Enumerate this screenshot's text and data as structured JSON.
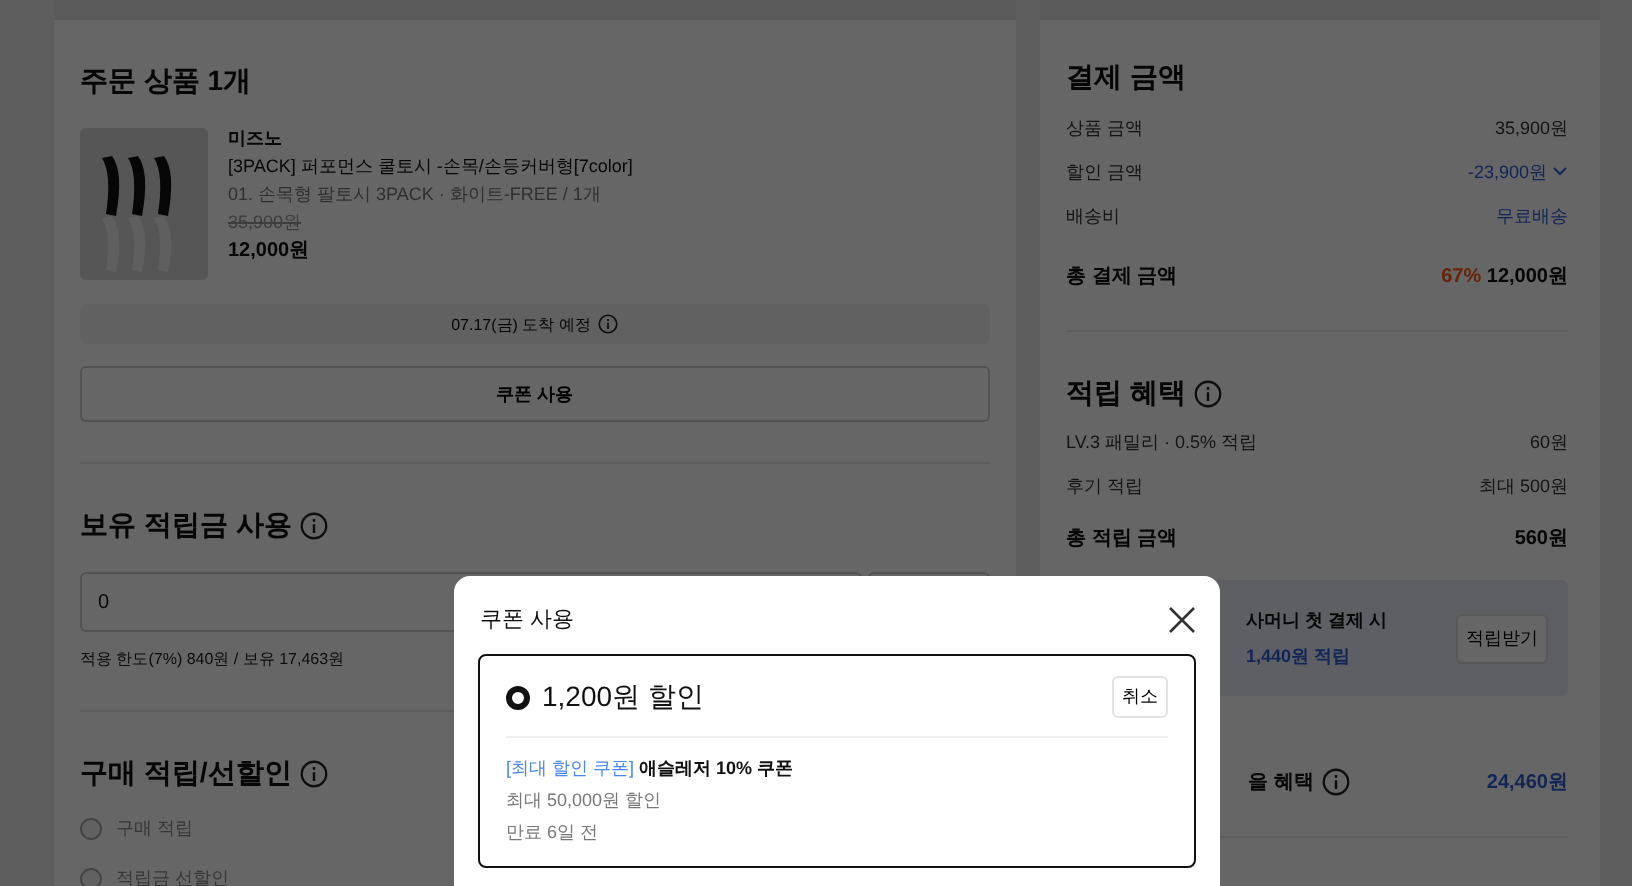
{
  "order": {
    "title": "주문 상품 1개",
    "product": {
      "brand": "미즈노",
      "name": "[3PACK] 퍼포먼스 쿨토시 -손목/손등커버형[7color]",
      "option": "01. 손목형 팔토시 3PACK · 화이트-FREE / 1개",
      "original_price": "35,900원",
      "price": "12,000원"
    },
    "delivery": "07.17(금) 도착 예정",
    "coupon_button": "쿠폰 사용"
  },
  "points": {
    "title": "보유 적립금 사용",
    "value": "0",
    "hint": "적용 한도(7%) 840원 / 보유 17,463원"
  },
  "purchase_benefit": {
    "title": "구매 적립/선할인",
    "options": [
      {
        "label": "구매 적립",
        "selected": false,
        "disabled": true
      },
      {
        "label": "적립금 선할인",
        "selected": false,
        "disabled": true
      }
    ]
  },
  "payment": {
    "title": "결제 금액",
    "rows": [
      {
        "label": "상품 금액",
        "value": "35,900원",
        "kind": "plain"
      },
      {
        "label": "할인 금액",
        "value": "-23,900원",
        "kind": "dropdown"
      },
      {
        "label": "배송비",
        "value": "무료배송",
        "kind": "link"
      }
    ],
    "total_label": "총 결제 금액",
    "discount_rate": "67%",
    "total": "12,000원"
  },
  "rewards": {
    "title": "적립 혜택",
    "rows": [
      {
        "label": "LV.3 패밀리 · 0.5% 적립",
        "value": "60원"
      },
      {
        "label": "후기 적립",
        "value": "최대 500원"
      }
    ],
    "total_label": "총 적립 금액",
    "total": "560원"
  },
  "promo": {
    "title": "사머니 첫 결제 시",
    "amount": "1,440원 적립",
    "button": "적립받기"
  },
  "benefit": {
    "label": "을 혜택",
    "value": "24,460원"
  },
  "modal": {
    "title": "쿠폰 사용",
    "coupon": {
      "selected": true,
      "discount": "1,200원 할인",
      "cancel": "취소",
      "tag": "[최대 할인 쿠폰]",
      "name": "애슬레저 10% 쿠폰",
      "max": "최대 50,000원 할인",
      "expiry": "만료 6일 전"
    }
  }
}
